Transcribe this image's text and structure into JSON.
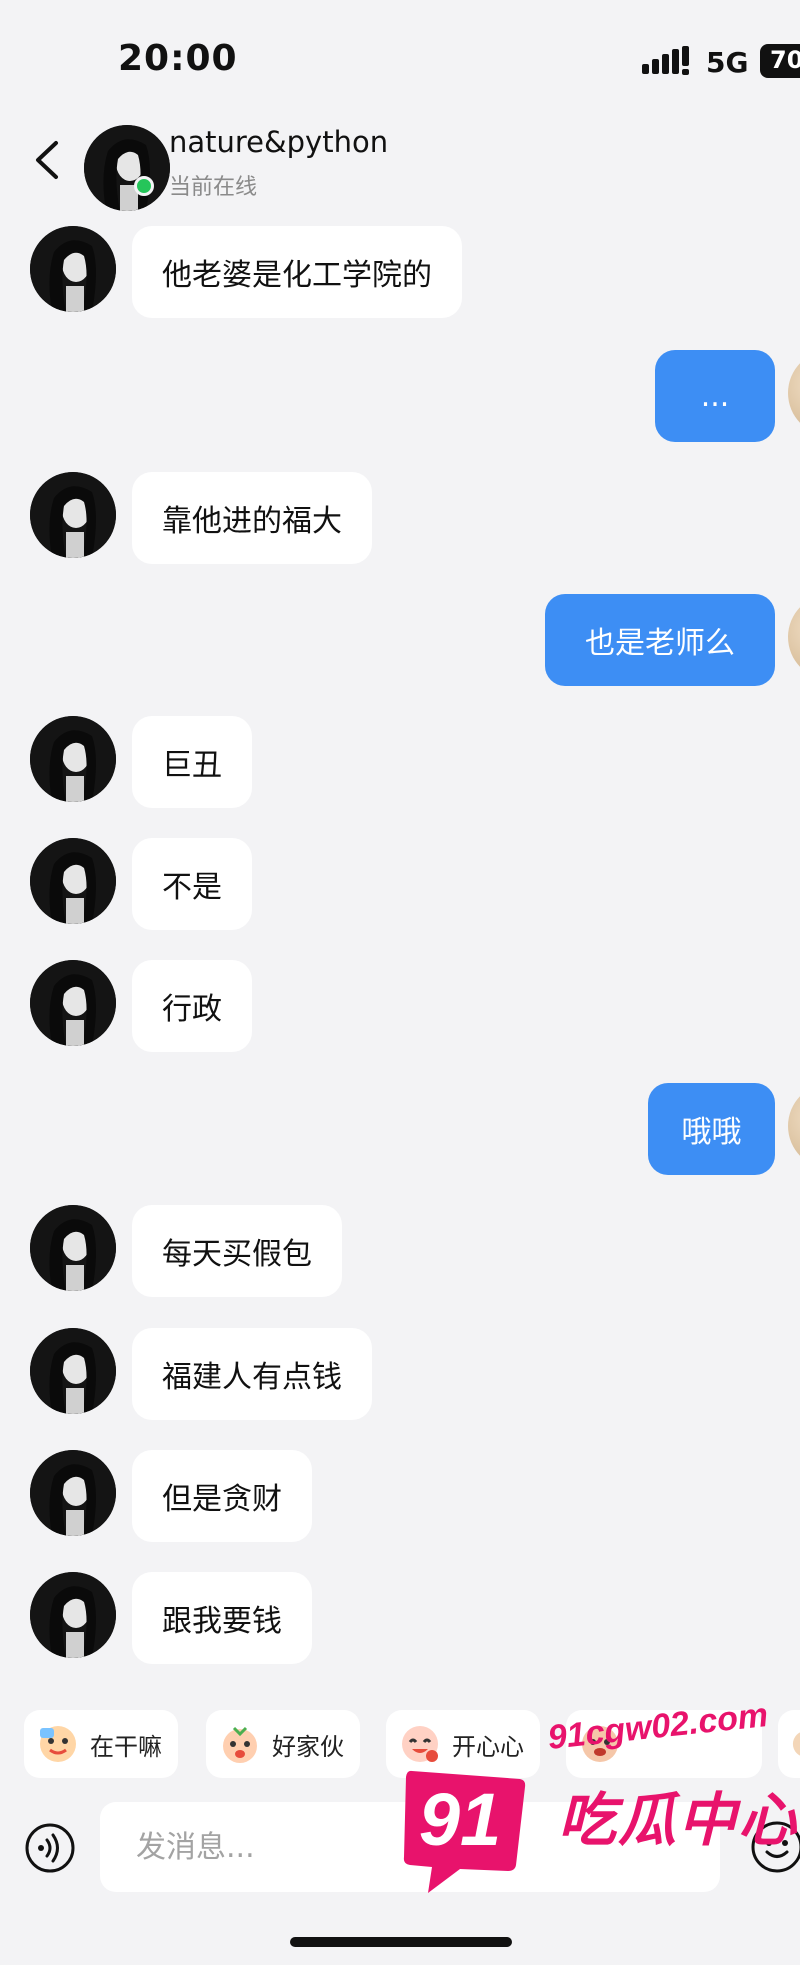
{
  "status_bar": {
    "time": "20:00",
    "network": "5G",
    "battery": "70"
  },
  "header": {
    "contact_name": "nature&python",
    "contact_status": "当前在线"
  },
  "messages": [
    {
      "side": "in",
      "text": "他老婆是化工学院的"
    },
    {
      "side": "out",
      "text": "..."
    },
    {
      "side": "in",
      "text": "靠他进的福大"
    },
    {
      "side": "out",
      "text": "也是老师么"
    },
    {
      "side": "in",
      "text": "巨丑"
    },
    {
      "side": "in",
      "text": "不是"
    },
    {
      "side": "in",
      "text": "行政"
    },
    {
      "side": "out",
      "text": "哦哦"
    },
    {
      "side": "in",
      "text": "每天买假包"
    },
    {
      "side": "in",
      "text": "福建人有点钱"
    },
    {
      "side": "in",
      "text": "但是贪财"
    },
    {
      "side": "in",
      "text": "跟我要钱"
    }
  ],
  "quick_replies": [
    {
      "label": "在干嘛",
      "icon": "sticker-face-icon"
    },
    {
      "label": "好家伙",
      "icon": "sticker-face-icon"
    },
    {
      "label": "开心心",
      "icon": "sticker-face-icon"
    },
    {
      "label": "",
      "icon": "sticker-face-icon"
    }
  ],
  "input": {
    "placeholder": "发消息..."
  },
  "watermark": {
    "badge": "91",
    "url": "91cgw02.com",
    "text": "吃瓜中心"
  },
  "colors": {
    "background": "#f3f3f5",
    "incoming_bubble": "#ffffff",
    "outgoing_bubble": "#3d8ef4",
    "online": "#25c55a",
    "watermark": "#e8136c"
  }
}
